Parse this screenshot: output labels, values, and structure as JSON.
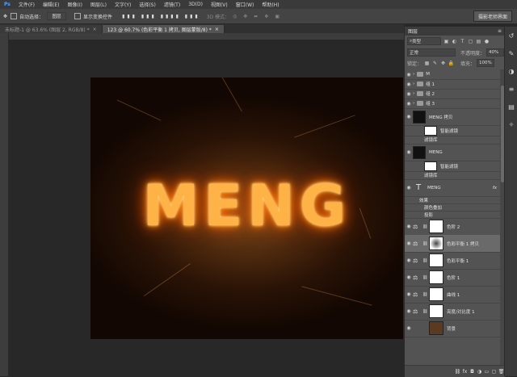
{
  "menu": [
    "文件(F)",
    "编辑(E)",
    "图像(I)",
    "图层(L)",
    "文字(Y)",
    "选择(S)",
    "滤镜(T)",
    "3D(D)",
    "视图(V)",
    "窗口(W)",
    "帮助(H)"
  ],
  "options": {
    "auto_select_label": "自动选择：",
    "auto_select_value": "图层",
    "show_transform_label": "显示变换控件",
    "mode_3d_label": "3D 模式：",
    "preset_label": "摄影老师界面"
  },
  "tabs": [
    {
      "label": "未标题-1 @ 63.6% (图层 2, RGB/8) *",
      "active": false
    },
    {
      "label": "123 @ 60.7% (色彩平衡 1 拷贝, 图层蒙版/8) *",
      "active": true
    }
  ],
  "canvas": {
    "text": "MENG"
  },
  "panel": {
    "title": "图层",
    "filter_label": "类型",
    "blend_mode": "正常",
    "opacity_label": "不透明度：",
    "opacity_value": "40%",
    "lock_label": "锁定：",
    "fill_label": "填充：",
    "fill_value": "100%"
  },
  "layers": [
    {
      "name": "M",
      "kind": "folder"
    },
    {
      "name": "组 1",
      "kind": "folder"
    },
    {
      "name": "组 2",
      "kind": "folder"
    },
    {
      "name": "组 3",
      "kind": "folder"
    },
    {
      "name": "MENG 拷贝",
      "kind": "smart"
    },
    {
      "name": "智能滤镜",
      "kind": "filter-mask"
    },
    {
      "name": "滤镜库",
      "kind": "filter"
    },
    {
      "name": "MENG",
      "kind": "smart"
    },
    {
      "name": "智能滤镜",
      "kind": "filter-mask"
    },
    {
      "name": "滤镜库",
      "kind": "filter"
    },
    {
      "name": "MENG",
      "kind": "text"
    },
    {
      "name": "效果",
      "kind": "effect-head"
    },
    {
      "name": "颜色叠加",
      "kind": "effect"
    },
    {
      "name": "投影",
      "kind": "effect"
    },
    {
      "name": "色阶 2",
      "kind": "adjust"
    },
    {
      "name": "色彩平衡 1 拷贝",
      "kind": "adjust-selected"
    },
    {
      "name": "色彩平衡 1",
      "kind": "adjust"
    },
    {
      "name": "色阶 1",
      "kind": "adjust"
    },
    {
      "name": "曲线 1",
      "kind": "adjust"
    },
    {
      "name": "亮度/对比度 1",
      "kind": "adjust"
    },
    {
      "name": "背景",
      "kind": "bg"
    }
  ],
  "footer_icons": [
    "link-icon",
    "fx-icon",
    "mask-icon",
    "adjustment-icon",
    "folder-icon",
    "new-layer-icon",
    "trash-icon"
  ],
  "colors": {
    "accent": "#ff9a1f",
    "panel": "#535353",
    "bg": "#282828"
  }
}
